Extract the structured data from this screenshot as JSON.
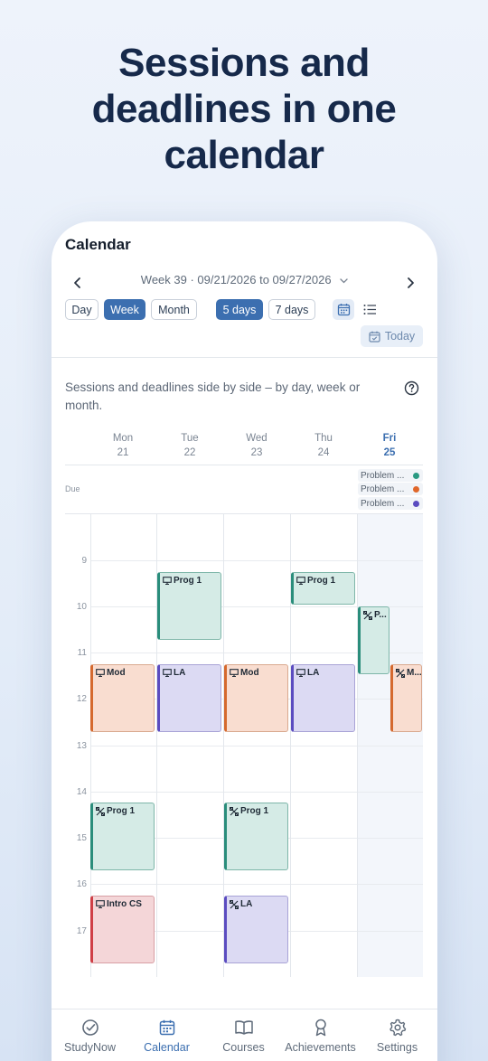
{
  "headline": [
    "Sessions and",
    "deadlines in one",
    "calendar"
  ],
  "app": {
    "title": "Calendar",
    "week_label": "Week 39 · 09/21/2026 to 09/27/2026",
    "view_buttons": [
      "Day",
      "Week",
      "Month"
    ],
    "active_view": "Week",
    "range_buttons": [
      "5 days",
      "7 days"
    ],
    "active_range": "5 days",
    "today_button": "Today",
    "description": "Sessions and deadlines side by side – by day, week or month.",
    "days": [
      {
        "name": "Mon",
        "date": "21"
      },
      {
        "name": "Tue",
        "date": "22"
      },
      {
        "name": "Wed",
        "date": "23"
      },
      {
        "name": "Thu",
        "date": "24"
      },
      {
        "name": "Fri",
        "date": "25"
      }
    ],
    "due_label": "Due",
    "due_items": [
      {
        "label": "Problem ...",
        "color": "#2a9a82"
      },
      {
        "label": "Problem ...",
        "color": "#e0672a"
      },
      {
        "label": "Problem ...",
        "color": "#5b4cc0"
      }
    ],
    "hours": [
      "9",
      "10",
      "11",
      "12",
      "13",
      "14",
      "15",
      "16",
      "17"
    ],
    "events": [
      {
        "label": "Prog 1",
        "icon": "presentation-icon",
        "color": "teal"
      },
      {
        "label": "Prog 1",
        "icon": "presentation-icon",
        "color": "teal"
      },
      {
        "label": "P...",
        "icon": "tools-icon",
        "color": "teal"
      },
      {
        "label": "Mod",
        "icon": "presentation-icon",
        "color": "orange"
      },
      {
        "label": "LA",
        "icon": "presentation-icon",
        "color": "purple"
      },
      {
        "label": "Mod",
        "icon": "presentation-icon",
        "color": "orange"
      },
      {
        "label": "LA",
        "icon": "presentation-icon",
        "color": "purple"
      },
      {
        "label": "M...",
        "icon": "tools-icon",
        "color": "orange"
      },
      {
        "label": "Prog 1",
        "icon": "tools-icon",
        "color": "teal"
      },
      {
        "label": "Prog 1",
        "icon": "tools-icon",
        "color": "teal"
      },
      {
        "label": "Intro CS",
        "icon": "presentation-icon",
        "color": "red"
      },
      {
        "label": "LA",
        "icon": "tools-icon",
        "color": "purple"
      }
    ],
    "tabs": [
      {
        "label": "StudyNow",
        "icon": "check-circle-icon"
      },
      {
        "label": "Calendar",
        "icon": "calendar-icon"
      },
      {
        "label": "Courses",
        "icon": "book-icon"
      },
      {
        "label": "Achievements",
        "icon": "medal-icon"
      },
      {
        "label": "Settings",
        "icon": "gear-icon"
      }
    ],
    "active_tab": "Calendar",
    "accent_color": "#3c6fb0"
  }
}
